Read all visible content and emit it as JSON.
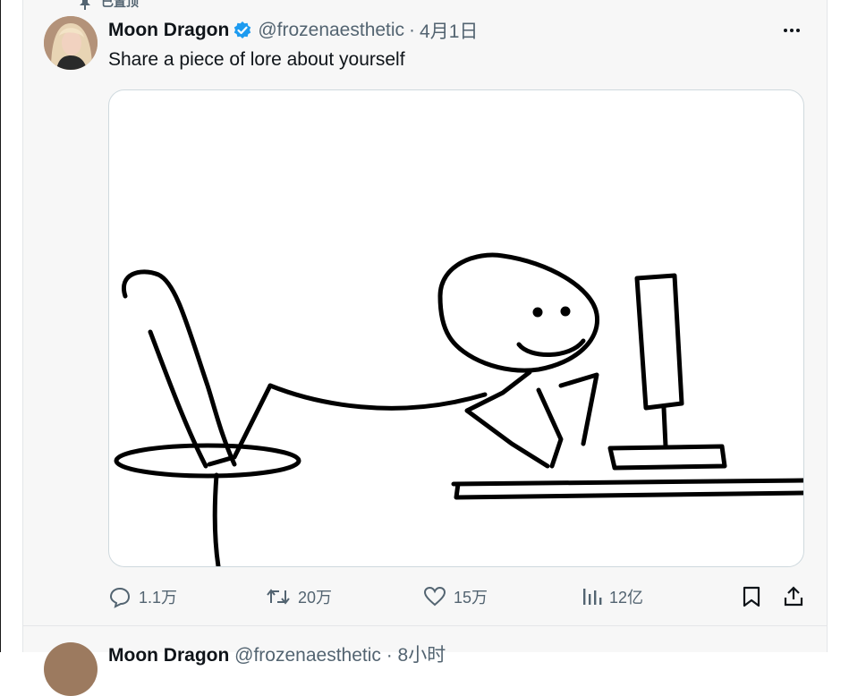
{
  "pinned_label": "已置顶",
  "tweet": {
    "display_name": "Moon Dragon",
    "handle": "@frozenaesthetic",
    "separator": "·",
    "date": "4月1日",
    "text": "Share a piece of lore about yourself",
    "media_description_icon": "stick-figure-at-computer-image"
  },
  "actions": {
    "replies": "1.1万",
    "retweets": "20万",
    "likes": "15万",
    "views": "12亿"
  },
  "next_tweet": {
    "display_name": "Moon Dragon",
    "handle": "@frozenaesthetic · 8小时"
  },
  "colors": {
    "verified_badge": "#1d9bf0",
    "secondary_text": "#536471",
    "primary_text": "#0f1419",
    "column_bg": "#f7f7f7"
  }
}
